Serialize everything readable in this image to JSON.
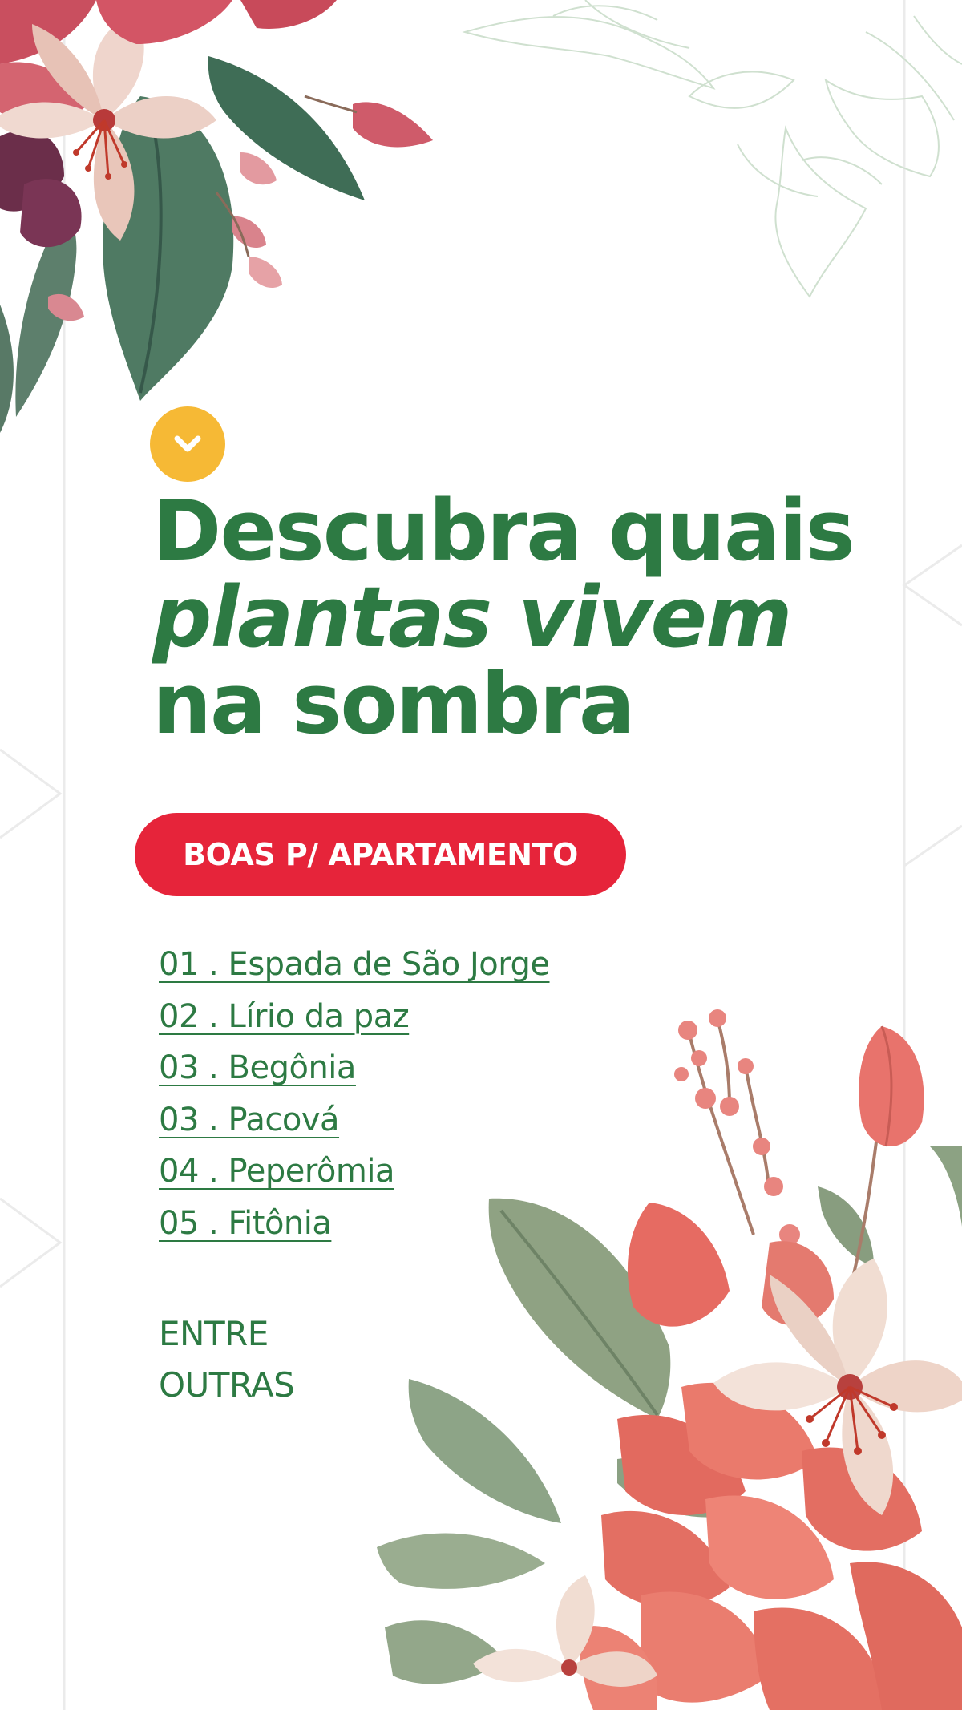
{
  "headline": {
    "line1": "Descubra quais",
    "line2": "plantas vivem",
    "line3": "na sombra"
  },
  "badge": {
    "label": "BOAS P/ APARTAMENTO"
  },
  "plants": [
    "01 . Espada de São Jorge",
    "02 . Lírio da paz",
    "03 . Begônia",
    "03 . Pacová",
    "04 . Peperômia",
    "05 . Fitônia"
  ],
  "footer": {
    "line1": "ENTRE",
    "line2": "OUTRAS"
  },
  "icons": {
    "badge_icon": "chevron-down-icon"
  },
  "colors": {
    "green": "#2d7a43",
    "red": "#e6243a",
    "yellow": "#f6b935",
    "background": "#ffffff"
  }
}
